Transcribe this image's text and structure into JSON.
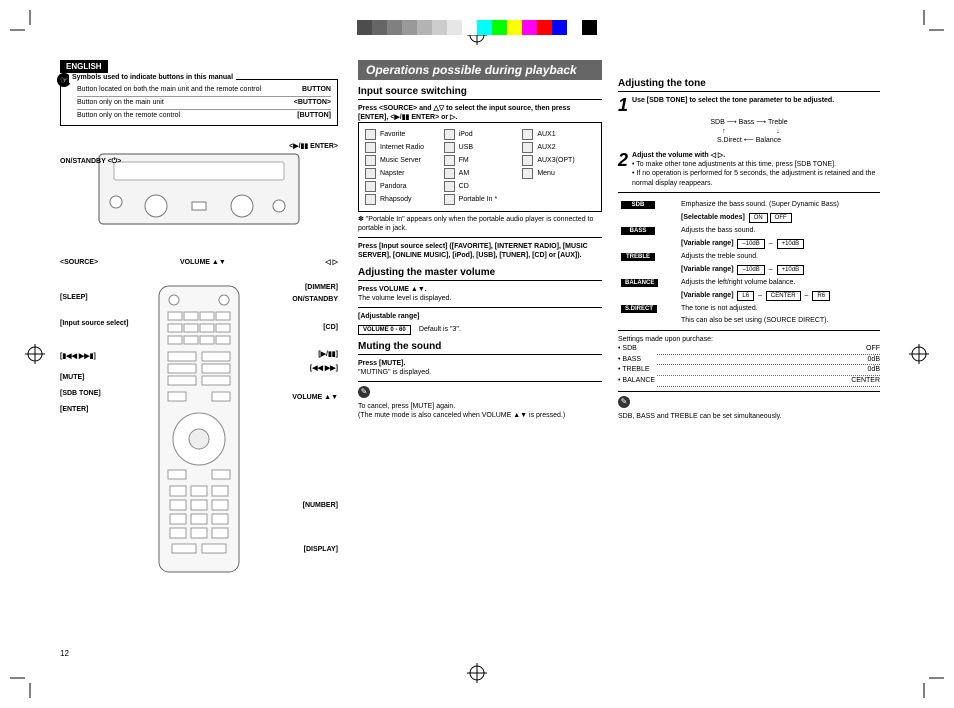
{
  "printmarks": {
    "colorbar": [
      "#4d4d4d",
      "#666",
      "#808080",
      "#999",
      "#b3b3b3",
      "#ccc",
      "#e6e6e6",
      "#fff",
      "#0ff",
      "#0f0",
      "#ff0",
      "#f0f",
      "#f00",
      "#00f",
      "#fff",
      "#000"
    ]
  },
  "language_tab": "ENGLISH",
  "page_number": "12",
  "symbol_box": {
    "heading": "Symbols used to indicate buttons in this manual",
    "rows": [
      {
        "desc": "Button located on both the main unit and the remote control",
        "sym": "BUTTON"
      },
      {
        "desc": "Button only on the main unit",
        "sym": "<BUTTON>"
      },
      {
        "desc": "Button only on the remote control",
        "sym": "[BUTTON]"
      }
    ]
  },
  "unit_labels": {
    "on_standby": "ON/STANDBY  <⏻>",
    "enter_top": "<▶/▮▮ ENTER>",
    "source": "<SOURCE>",
    "volume": "VOLUME ▲▼",
    "cursor": "◁  ▷"
  },
  "remote_labels": {
    "sleep": "[SLEEP]",
    "input": "[Input source select]",
    "skip": "[▮◀◀  ▶▶▮]",
    "mute": "[MUTE]",
    "sdb": "[SDB TONE]",
    "enter": "[ENTER]",
    "dimmer": "[DIMMER]",
    "standby": "ON/STANDBY",
    "cd": "[CD]",
    "play": "[▶/▮▮]",
    "scan": "[◀◀  ▶▶]",
    "volume": "VOLUME ▲▼",
    "number": "[NUMBER]",
    "display": "[DISPLAY]"
  },
  "banner_title": "Operations possible during playback",
  "input_source": {
    "heading": "Input source switching",
    "press_line": "Press <SOURCE> and △▽ to select the input source, then press [ENTER], <▶/▮▮ ENTER> or ▷.",
    "grid": [
      [
        "Favorite",
        "iPod",
        "AUX1"
      ],
      [
        "Internet Radio",
        "USB",
        "AUX2"
      ],
      [
        "Music Server",
        "FM",
        "AUX3(OPT)"
      ],
      [
        "Napster",
        "AM",
        "Menu"
      ],
      [
        "Pandora",
        "CD",
        ""
      ],
      [
        "Rhapsody",
        "Portable In *",
        ""
      ]
    ],
    "star_note": "✽ \"Portable In\" appears only when the portable audio player is connected to portable in jack.",
    "press2": "Press [Input source select] ([FAVORITE], [INTERNET RADIO], [MUSIC SERVER], [ONLINE MUSIC], [iPod], [USB], [TUNER], [CD] or [AUX])."
  },
  "master_volume": {
    "heading": "Adjusting the master volume",
    "press": "Press VOLUME ▲▼.",
    "note": "The volume level is displayed.",
    "range_label": "[Adjustable range]",
    "range_box": "VOLUME 0 - 60",
    "default": "Default is \"3\"."
  },
  "muting": {
    "heading": "Muting the sound",
    "press": "Press [MUTE].",
    "note": "\"MUTING\" is displayed.",
    "cancel1": "To cancel, press [MUTE] again.",
    "cancel2": "(The mute mode is also canceled when VOLUME ▲▼ is pressed.)"
  },
  "tone": {
    "heading": "Adjusting the tone",
    "step1": "Use [SDB TONE] to select the tone parameter to be adjusted.",
    "flow": [
      "SDB",
      "Bass",
      "Treble",
      "S.Direct",
      "Balance"
    ],
    "step2": "Adjust the volume with ◁ ▷.",
    "step2_notes": [
      "To make other tone adjustments at this time, press [SDB TONE].",
      "If no operation is performed for 5 seconds, the adjustment is retained and the normal display reappears."
    ],
    "table": [
      {
        "label": "SDB",
        "desc": "Emphasize the bass sound. (Super Dynamic Bass)",
        "sub": "[Selectable modes]",
        "vals": [
          "ON",
          "OFF"
        ]
      },
      {
        "label": "BASS",
        "desc": "Adjusts the bass sound.",
        "sub": "[Variable range]",
        "vals": [
          "–10dB",
          "–",
          "+10dB"
        ]
      },
      {
        "label": "TREBLE",
        "desc": "Adjusts the treble sound.",
        "sub": "[Variable range]",
        "vals": [
          "–10dB",
          "–",
          "+10dB"
        ]
      },
      {
        "label": "BALANCE",
        "desc": "Adjusts the left/right volume balance.",
        "sub": "[Variable range]",
        "vals": [
          "L6",
          "–",
          "CENTER",
          "–",
          "R6"
        ]
      },
      {
        "label": "S.DIRECT",
        "desc": "The tone is not adjusted.",
        "sub": "",
        "vals": [],
        "extra": "This can also be set using (SOURCE DIRECT)."
      }
    ],
    "defaults_heading": "Settings made upon purchase:",
    "defaults": [
      {
        "k": "SDB",
        "v": "OFF"
      },
      {
        "k": "BASS",
        "v": "0dB"
      },
      {
        "k": "TREBLE",
        "v": "0dB"
      },
      {
        "k": "BALANCE",
        "v": "CENTER"
      }
    ],
    "footer_note": "SDB, BASS and TREBLE can be set simultaneously."
  }
}
